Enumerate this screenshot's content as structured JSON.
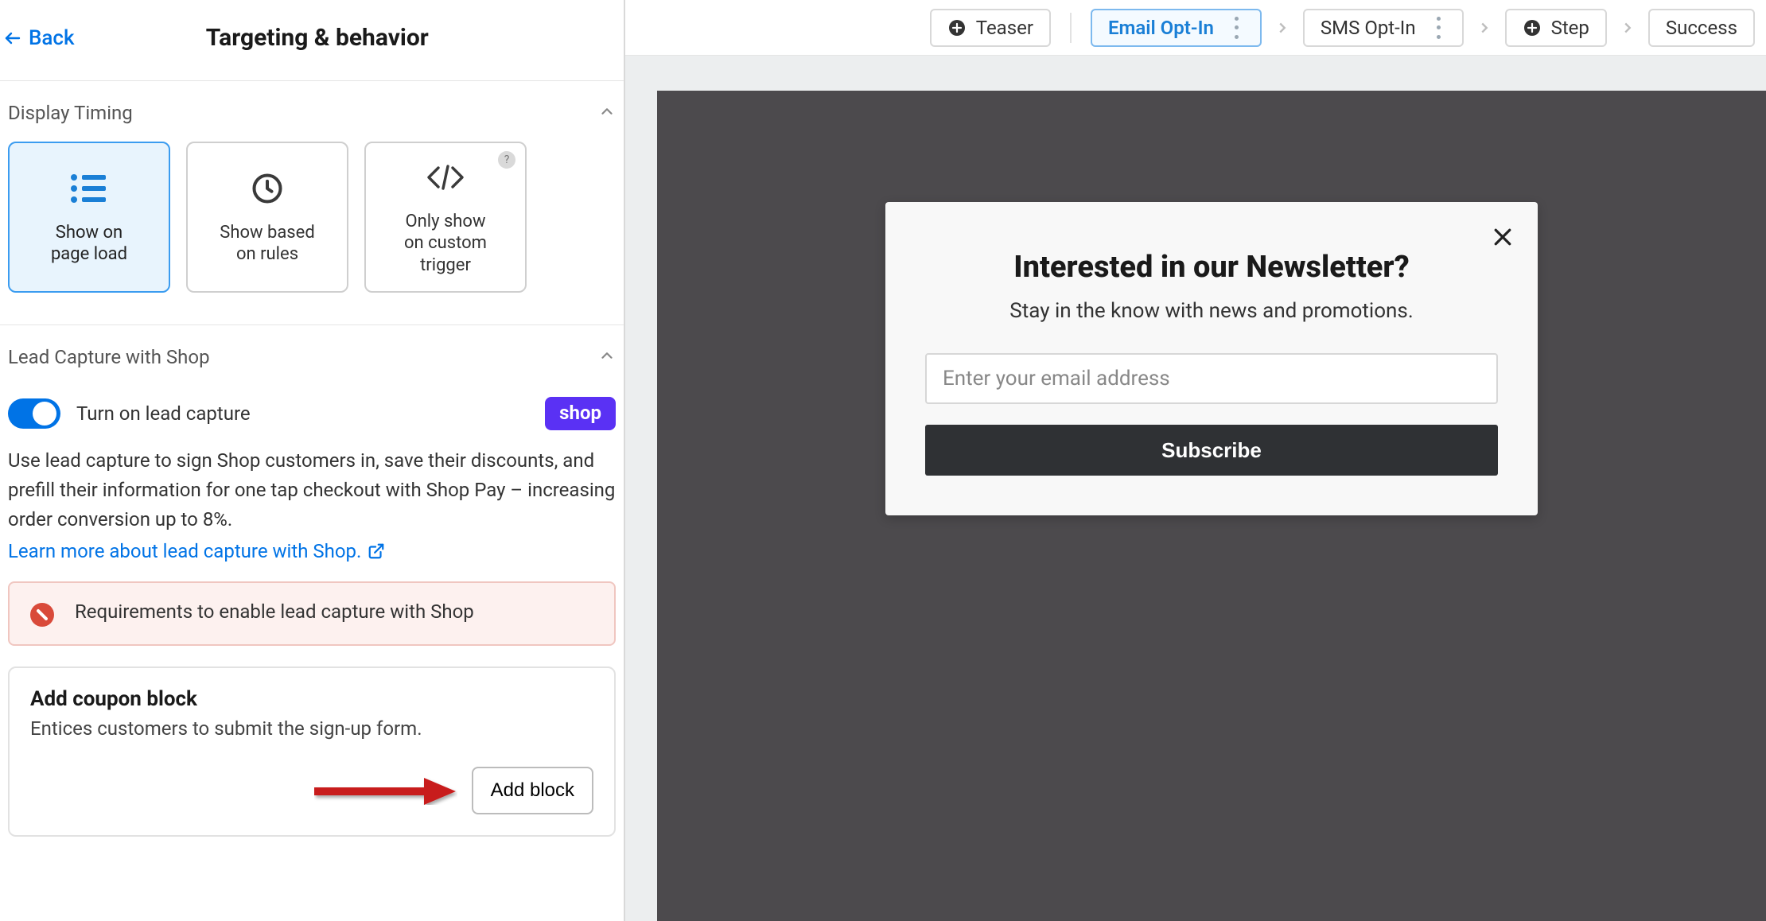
{
  "header": {
    "back_label": "Back",
    "title": "Targeting & behavior"
  },
  "sections": {
    "display_timing": {
      "title": "Display Timing",
      "options": [
        {
          "label_line1": "Show on",
          "label_line2": "page load"
        },
        {
          "label_line1": "Show based",
          "label_line2": "on rules"
        },
        {
          "label_line1": "Only show",
          "label_line2": "on custom",
          "label_line3": "trigger"
        }
      ]
    },
    "lead_capture": {
      "title": "Lead Capture with Shop",
      "toggle_label": "Turn on lead capture",
      "shop_badge": "shop",
      "description": "Use lead capture to sign Shop customers in, save their discounts, and prefill their information for one tap checkout with Shop Pay – increasing order conversion up to 8%.",
      "learn_more": "Learn more about lead capture with Shop.",
      "warning": "Requirements to enable lead capture with Shop",
      "coupon": {
        "title": "Add coupon block",
        "desc": "Entices customers to submit the sign-up form.",
        "button": "Add block"
      }
    }
  },
  "steps": {
    "teaser": "Teaser",
    "email_optin": "Email Opt-In",
    "sms_optin": "SMS Opt-In",
    "step": "Step",
    "success": "Success"
  },
  "popup": {
    "heading": "Interested in our Newsletter?",
    "subheading": "Stay in the know with news and promotions.",
    "email_placeholder": "Enter your email address",
    "subscribe": "Subscribe"
  }
}
